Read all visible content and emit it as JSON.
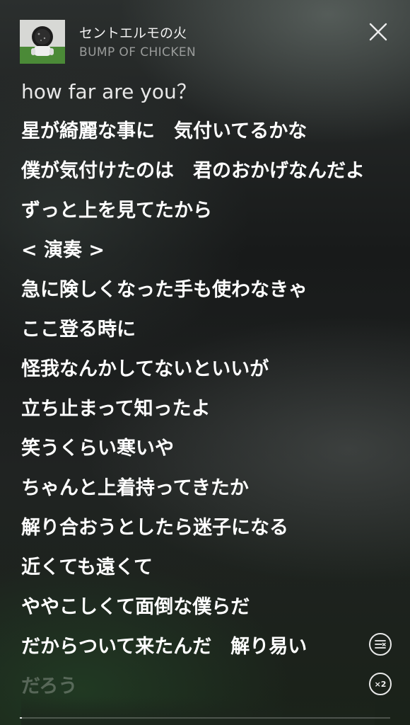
{
  "now_playing": {
    "title": "セントエルモの火",
    "artist": "BUMP OF CHICKEN",
    "artwork_icon": "album-artwork-astronaut"
  },
  "controls": {
    "close_icon": "close-icon",
    "translate_icon": "lyrics-translate-icon",
    "speed_label": "×2"
  },
  "progress": {
    "fraction": 0.006
  },
  "lyrics": [
    "how far are you？",
    "星が綺麗な事に　気付いてるかな",
    "僕が気付けたのは　君のおかげなんだよ",
    "ずっと上を見てたから",
    "< 演奏 >",
    "急に険しくなった手も使わなきゃ",
    "ここ登る時に",
    "怪我なんかしてないといいが",
    "立ち止まって知ったよ",
    "笑うくらい寒いや",
    "ちゃんと上着持ってきたか",
    "解り合おうとしたら迷子になる",
    "近くても遠くて",
    "ややこしくて面倒な僕らだ",
    "だからついて来たんだ　解り易い",
    "だろう"
  ]
}
